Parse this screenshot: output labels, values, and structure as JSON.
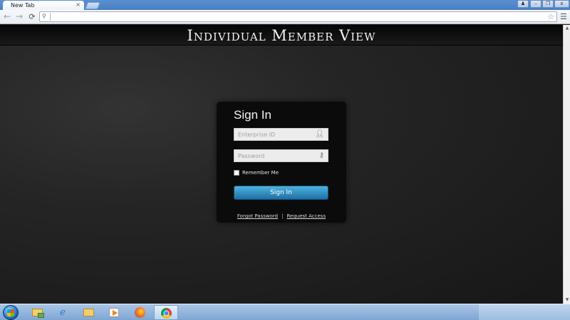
{
  "browser": {
    "tab_title": "New Tab",
    "tab_close": "×",
    "address_value": "",
    "window_controls": {
      "user": "♟",
      "minimize": "–",
      "maximize": "❐",
      "close": "x"
    }
  },
  "page": {
    "title": "Individual Member View",
    "login": {
      "heading": "Sign In",
      "enterprise_id_placeholder": "Enterprise ID",
      "password_placeholder": "Password",
      "remember_label": "Remember Me",
      "remember_checked": false,
      "sign_in_label": "Sign In",
      "forgot_label": "Forgot Password",
      "separator": "|",
      "request_label": "Request Access"
    }
  },
  "taskbar": {
    "apps": [
      "windows-explorer",
      "internet-explorer",
      "file-explorer",
      "media-player",
      "firefox",
      "chrome"
    ],
    "active_app": "chrome"
  },
  "colors": {
    "header_bar": "#0a0a0a",
    "page_background": "#1e1e1e",
    "login_panel": "#0b0b0b",
    "sign_in_button": "#2f8fc4",
    "title_text": "#f2f2f2"
  },
  "icons": {
    "back": "arrow-left-icon",
    "forward": "arrow-right-icon",
    "reload": "reload-icon",
    "search": "search-icon",
    "bookmark": "star-icon",
    "menu": "hamburger-menu-icon",
    "user_field": "user-icon",
    "password_field": "key-icon"
  }
}
